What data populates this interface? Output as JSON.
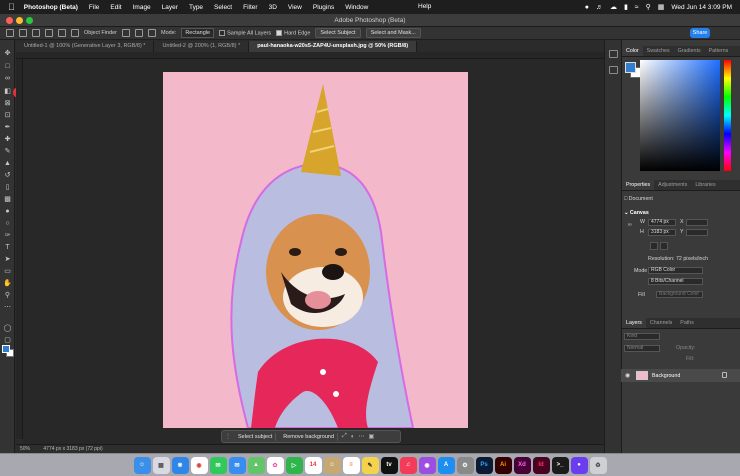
{
  "menubar": {
    "app_name": "Photoshop (Beta)",
    "menus": [
      "File",
      "Edit",
      "Image",
      "Layer",
      "Type",
      "Select",
      "Filter",
      "3D",
      "View",
      "Plugins",
      "Window"
    ],
    "help": "Help",
    "clock": "Wed Jun 14  3:09 PM"
  },
  "window": {
    "title": "Adobe Photoshop (Beta)"
  },
  "options_bar": {
    "object_finder": "Object Finder",
    "mode_label": "Mode:",
    "mode_value": "Rectangle",
    "sample_all_layers": "Sample All Layers",
    "hard_edge": "Hard Edge",
    "select_subject": "Select Subject",
    "select_and_mask": "Select and Mask...",
    "share": "Share"
  },
  "tabs": [
    {
      "label": "Untitled-1 @ 100% (Generative Layer 3, RGB/8) *"
    },
    {
      "label": "Untitled-2 @ 200% (1, RGB/8) *"
    },
    {
      "label": "paul-hanaoka-w20s5-ZAP4U-unsplash.jpg @ 50% (RGB/8)"
    }
  ],
  "toolbar": {
    "step_badge": "1"
  },
  "taskbar": {
    "select_subject": "Select subject",
    "remove_background": "Remove background"
  },
  "statusbar": {
    "zoom": "50%",
    "doc_info": "4774 px x 3183 px (72 ppi)"
  },
  "color_panel": {
    "tabs": [
      "Color",
      "Swatches",
      "Gradients",
      "Patterns"
    ],
    "foreground": "#2f7ecf",
    "background": "#ffffff"
  },
  "properties_panel": {
    "tabs": [
      "Properties",
      "Adjustments",
      "Libraries"
    ],
    "document_label": "Document",
    "canvas_label": "Canvas",
    "width": "4774 px",
    "height": "3183 px",
    "x_label": "X",
    "y_label": "Y",
    "w_label": "W",
    "h_label": "H",
    "resolution": "Resolution: 72 pixels/inch",
    "mode_label": "Mode",
    "mode_value": "RGB Color",
    "depth_value": "8 Bits/Channel",
    "fill_label": "Fill",
    "fill_value": "Background Color"
  },
  "layers_panel": {
    "tabs": [
      "Layers",
      "Channels",
      "Paths"
    ],
    "search_placeholder": "Kind",
    "blend_mode": "Normal",
    "opacity_label": "Opacity:",
    "fill_label": "Fill:",
    "layer_name": "Background"
  },
  "dock_icons": [
    "finder",
    "launchpad",
    "safari",
    "chrome",
    "messages",
    "mail",
    "maps",
    "photos",
    "facetime",
    "calendar",
    "contacts",
    "reminders",
    "notes",
    "tv",
    "music",
    "podcasts",
    "app-store",
    "system-settings",
    "photoshop",
    "illustrator",
    "xd",
    "indesign"
  ],
  "calendar_day": "14",
  "accent_colors": {
    "pink_canvas": "#f3b8c9",
    "share_blue": "#2680eb",
    "badge_red": "#e0323a"
  }
}
